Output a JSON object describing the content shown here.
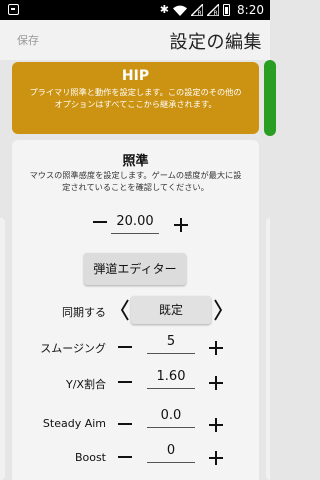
{
  "status_bar": {
    "time": "8:20",
    "bluetooth_glyph": "✱",
    "icons": [
      "notification-icon",
      "bluetooth-icon",
      "wifi-icon",
      "signal-icon",
      "signal-icon",
      "battery-icon"
    ]
  },
  "header": {
    "save_label": "保存",
    "title": "設定の編集"
  },
  "hip_card": {
    "title": "HIP",
    "description": "プライマリ照準と動作を設定します。この設定のその他のオプションはすべてここから継承されます。",
    "color": "#cc9312"
  },
  "aim_section": {
    "title": "照準",
    "description": "マウスの照準感度を設定します。ゲームの感度が最大に設定されていることを確認してください。",
    "sensitivity_value": "20.00",
    "ballistics_button": "弾道エディター"
  },
  "sync_row": {
    "label": "同期する",
    "value": "既定"
  },
  "settings": [
    {
      "label": "スムージング",
      "value": "5"
    },
    {
      "label": "Y/X割合",
      "value": "1.60"
    },
    {
      "label": "Steady Aim",
      "value": "0.0"
    },
    {
      "label": "Boost",
      "value": "0"
    }
  ],
  "colors": {
    "accent_green": "#2a9d23",
    "hip_gold": "#cc9312"
  }
}
